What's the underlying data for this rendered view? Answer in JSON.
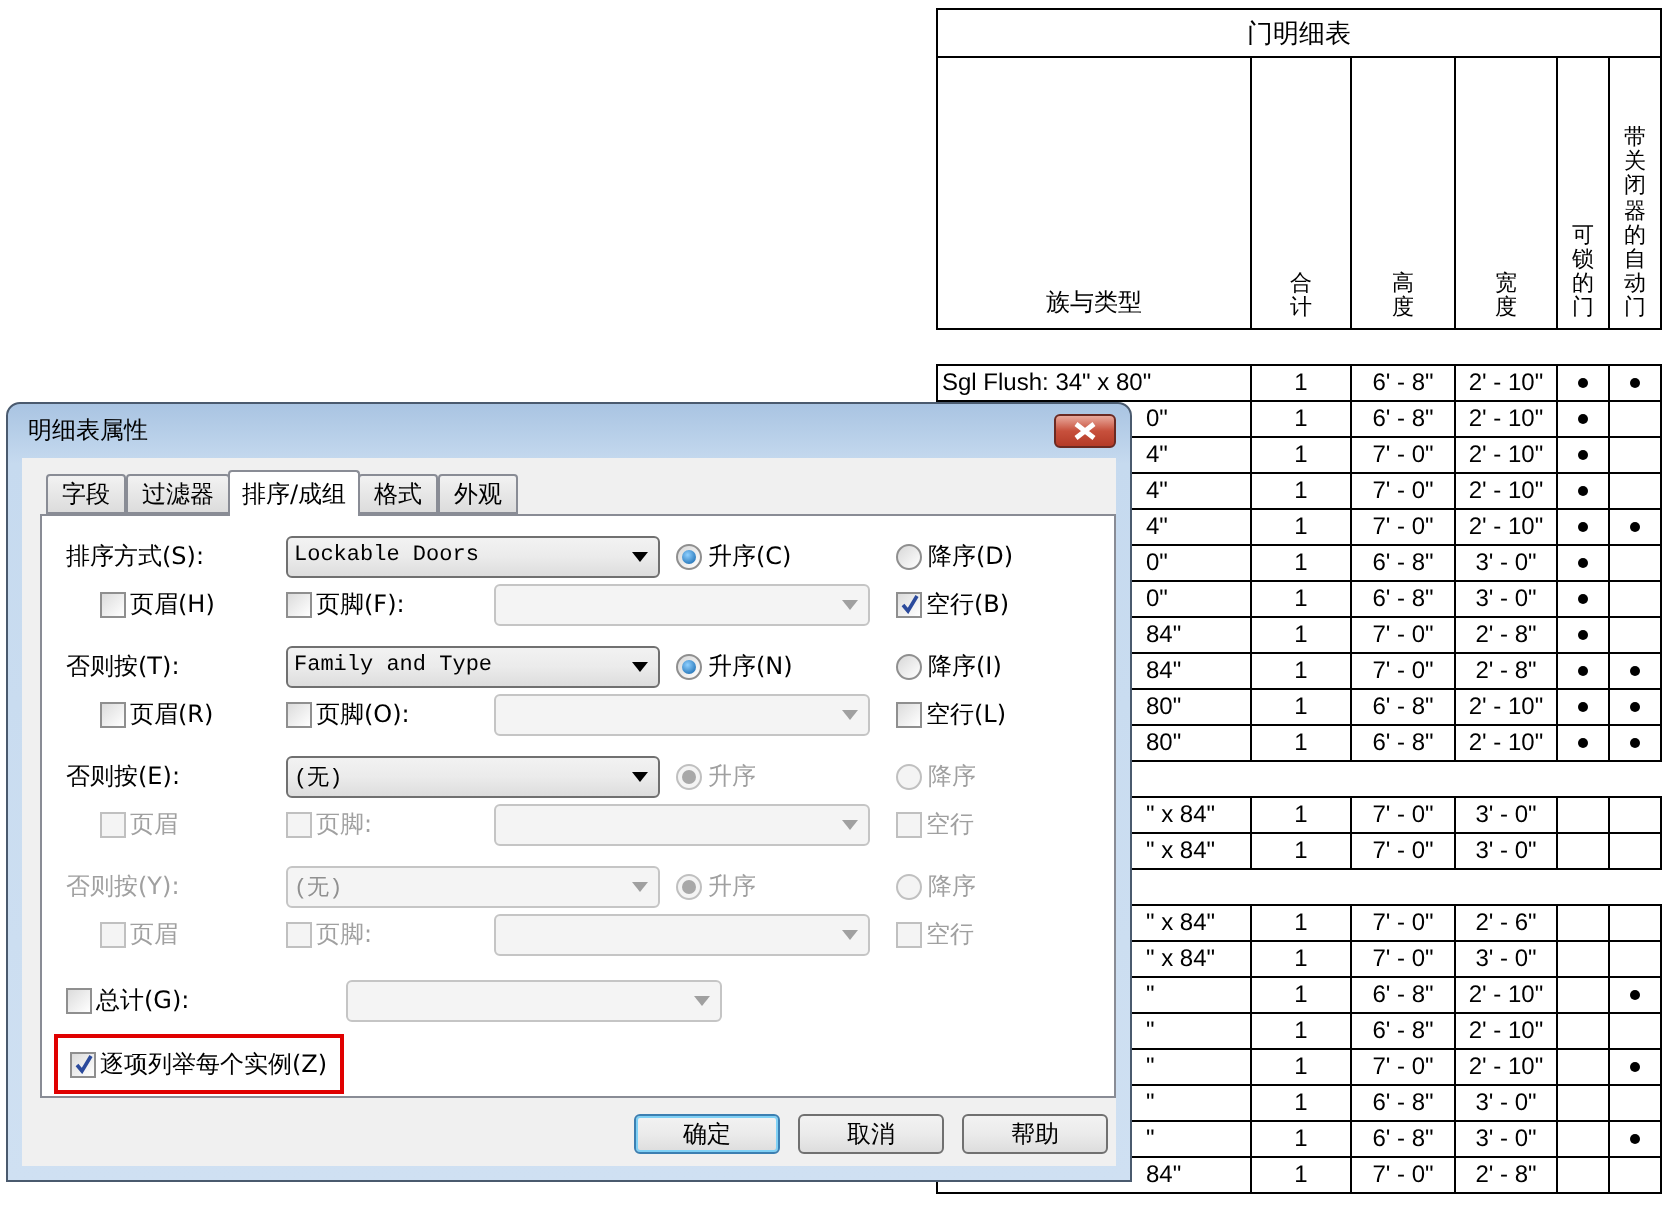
{
  "schedule": {
    "title": "门明细表",
    "columns": [
      {
        "label": "族与类型",
        "kind": "horizontal"
      },
      {
        "label": "合计",
        "kind": "vertical"
      },
      {
        "label": "高度",
        "kind": "vertical"
      },
      {
        "label": "宽度",
        "kind": "vertical"
      },
      {
        "label": "可锁的门",
        "kind": "vertical"
      },
      {
        "label": "带关闭器的自动门",
        "kind": "vertical"
      }
    ],
    "groups": [
      {
        "rows": [
          {
            "family": "Sgl Flush: 34\" x 80\"",
            "cut": false,
            "count": "1",
            "height": "6' - 8\"",
            "width": "2' - 10\"",
            "lockable": true,
            "closer": true
          },
          {
            "family": "0\"",
            "cut": true,
            "count": "1",
            "height": "6' - 8\"",
            "width": "2' - 10\"",
            "lockable": true,
            "closer": false
          },
          {
            "family": "4\"",
            "cut": true,
            "count": "1",
            "height": "7' - 0\"",
            "width": "2' - 10\"",
            "lockable": true,
            "closer": false
          },
          {
            "family": "4\"",
            "cut": true,
            "count": "1",
            "height": "7' - 0\"",
            "width": "2' - 10\"",
            "lockable": true,
            "closer": false
          },
          {
            "family": "4\"",
            "cut": true,
            "count": "1",
            "height": "7' - 0\"",
            "width": "2' - 10\"",
            "lockable": true,
            "closer": true
          },
          {
            "family": "0\"",
            "cut": true,
            "count": "1",
            "height": "6' - 8\"",
            "width": "3' - 0\"",
            "lockable": true,
            "closer": false
          },
          {
            "family": "0\"",
            "cut": true,
            "count": "1",
            "height": "6' - 8\"",
            "width": "3' - 0\"",
            "lockable": true,
            "closer": false
          },
          {
            "family": "84\"",
            "cut": true,
            "count": "1",
            "height": "7' - 0\"",
            "width": "2' - 8\"",
            "lockable": true,
            "closer": false
          },
          {
            "family": "84\"",
            "cut": true,
            "count": "1",
            "height": "7' - 0\"",
            "width": "2' - 8\"",
            "lockable": true,
            "closer": true
          },
          {
            "family": "80\"",
            "cut": true,
            "count": "1",
            "height": "6' - 8\"",
            "width": "2' - 10\"",
            "lockable": true,
            "closer": true
          },
          {
            "family": "80\"",
            "cut": true,
            "count": "1",
            "height": "6' - 8\"",
            "width": "2' - 10\"",
            "lockable": true,
            "closer": true
          }
        ]
      },
      {
        "rows": [
          {
            "family": "\" x 84\"",
            "cut": true,
            "count": "1",
            "height": "7' - 0\"",
            "width": "3' - 0\"",
            "lockable": false,
            "closer": false
          },
          {
            "family": "\" x 84\"",
            "cut": true,
            "count": "1",
            "height": "7' - 0\"",
            "width": "3' - 0\"",
            "lockable": false,
            "closer": false
          }
        ]
      },
      {
        "rows": [
          {
            "family": "\" x 84\"",
            "cut": true,
            "count": "1",
            "height": "7' - 0\"",
            "width": "2' - 6\"",
            "lockable": false,
            "closer": false
          },
          {
            "family": "\" x 84\"",
            "cut": true,
            "count": "1",
            "height": "7' - 0\"",
            "width": "3' - 0\"",
            "lockable": false,
            "closer": false
          },
          {
            "family": "\"",
            "cut": true,
            "count": "1",
            "height": "6' - 8\"",
            "width": "2' - 10\"",
            "lockable": false,
            "closer": true
          },
          {
            "family": "\"",
            "cut": true,
            "count": "1",
            "height": "6' - 8\"",
            "width": "2' - 10\"",
            "lockable": false,
            "closer": false
          },
          {
            "family": "\"",
            "cut": true,
            "count": "1",
            "height": "7' - 0\"",
            "width": "2' - 10\"",
            "lockable": false,
            "closer": true
          },
          {
            "family": "\"",
            "cut": true,
            "count": "1",
            "height": "6' - 8\"",
            "width": "3' - 0\"",
            "lockable": false,
            "closer": false
          },
          {
            "family": "\"",
            "cut": true,
            "count": "1",
            "height": "6' - 8\"",
            "width": "3' - 0\"",
            "lockable": false,
            "closer": true
          },
          {
            "family": "84\"",
            "cut": true,
            "count": "1",
            "height": "7' - 0\"",
            "width": "2' - 8\"",
            "lockable": false,
            "closer": false
          }
        ]
      }
    ]
  },
  "dialog": {
    "title": "明细表属性",
    "tabs": [
      {
        "label": "字段",
        "selected": false
      },
      {
        "label": "过滤器",
        "selected": false
      },
      {
        "label": "排序/成组",
        "selected": true
      },
      {
        "label": "格式",
        "selected": false
      },
      {
        "label": "外观",
        "selected": false
      }
    ],
    "levels": [
      {
        "label": "排序方式(S):",
        "label_disabled": false,
        "field": "Lockable Doors",
        "field_disabled": false,
        "order": [
          {
            "label": "升序(C)",
            "selected": true
          },
          {
            "label": "降序(D)",
            "selected": false
          }
        ],
        "order_disabled": false,
        "header": {
          "label": "页眉(H)",
          "checked": false
        },
        "footer": {
          "label": "页脚(F):",
          "checked": false
        },
        "blank_line": {
          "label": "空行(B)",
          "checked": true
        },
        "options_disabled": false
      },
      {
        "label": "否则按(T):",
        "label_disabled": false,
        "field": "Family and Type",
        "field_disabled": false,
        "order": [
          {
            "label": "升序(N)",
            "selected": true
          },
          {
            "label": "降序(I)",
            "selected": false
          }
        ],
        "order_disabled": false,
        "header": {
          "label": "页眉(R)",
          "checked": false
        },
        "footer": {
          "label": "页脚(O):",
          "checked": false
        },
        "blank_line": {
          "label": "空行(L)",
          "checked": false
        },
        "options_disabled": false
      },
      {
        "label": "否则按(E):",
        "label_disabled": false,
        "field": "(无)",
        "field_disabled": false,
        "order": [
          {
            "label": "升序",
            "selected": true
          },
          {
            "label": "降序",
            "selected": false
          }
        ],
        "order_disabled": true,
        "header": {
          "label": "页眉",
          "checked": false
        },
        "footer": {
          "label": "页脚:",
          "checked": false
        },
        "blank_line": {
          "label": "空行",
          "checked": false
        },
        "options_disabled": true
      },
      {
        "label": "否则按(Y):",
        "label_disabled": true,
        "field": "(无)",
        "field_disabled": true,
        "order": [
          {
            "label": "升序",
            "selected": true
          },
          {
            "label": "降序",
            "selected": false
          }
        ],
        "order_disabled": true,
        "header": {
          "label": "页眉",
          "checked": false
        },
        "footer": {
          "label": "页脚:",
          "checked": false
        },
        "blank_line": {
          "label": "空行",
          "checked": false
        },
        "options_disabled": true
      }
    ],
    "grand_total": {
      "label": "总计(G):",
      "checked": false
    },
    "itemize": {
      "label": "逐项列举每个实例(Z)",
      "checked": true,
      "highlighted": true
    },
    "buttons": [
      {
        "label": "确定",
        "default": true
      },
      {
        "label": "取消",
        "default": false
      },
      {
        "label": "帮助",
        "default": false
      }
    ]
  }
}
